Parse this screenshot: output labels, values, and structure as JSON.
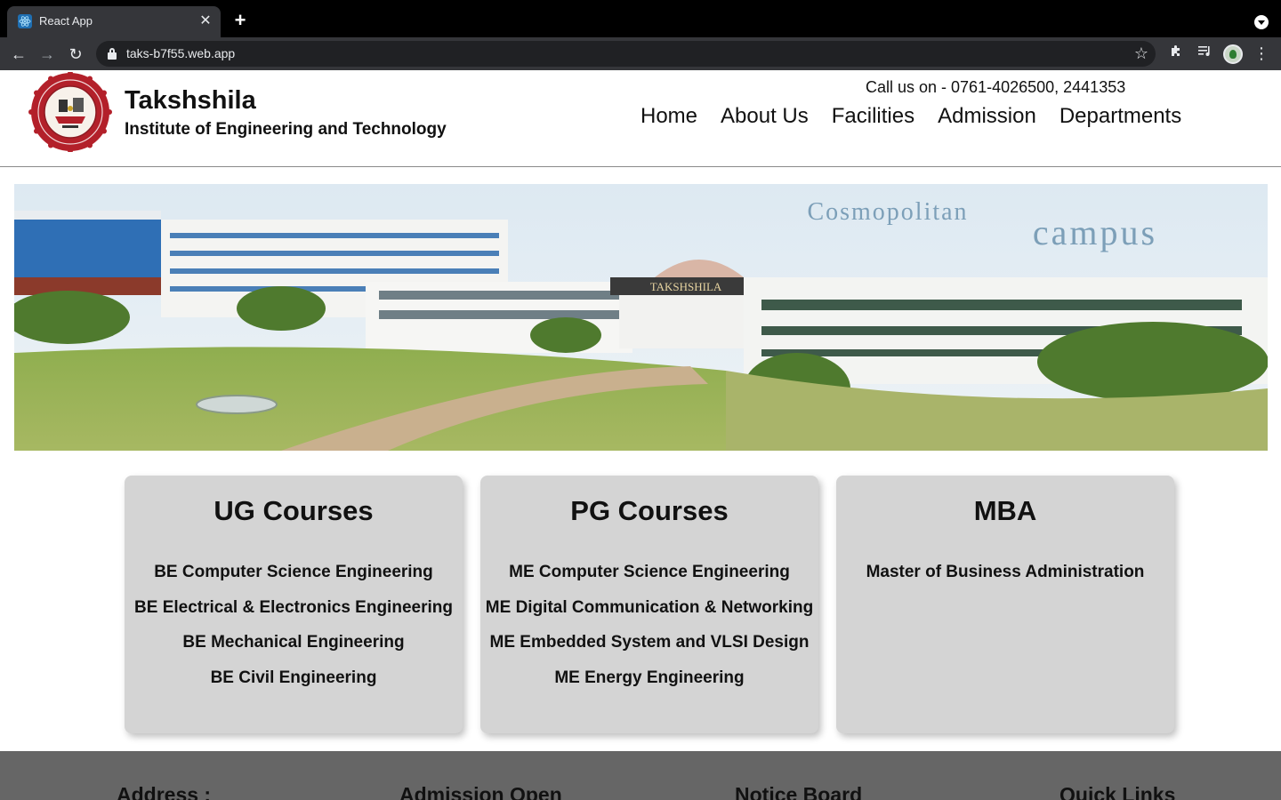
{
  "browser": {
    "tab_title": "React App",
    "tab_close": "✕",
    "new_tab": "+",
    "url": "taks-b7f55.web.app"
  },
  "header": {
    "brand_name": "Takshshila",
    "brand_subtitle": "Institute of Engineering and Technology",
    "phone": "Call us on - 0761-4026500, 2441353",
    "nav": [
      "Home",
      "About Us",
      "Facilities",
      "Admission",
      "Departments"
    ]
  },
  "hero": {
    "caption_line1": "Cosmopolitan",
    "caption_line2": "campus",
    "building_sign": "TAKSHSHILA"
  },
  "courses": [
    {
      "title": "UG Courses",
      "items": [
        "BE Computer Science Engineering",
        "BE Electrical & Electronics Engineering",
        "BE Mechanical Engineering",
        "BE Civil Engineering"
      ]
    },
    {
      "title": "PG Courses",
      "items": [
        "ME Computer Science Engineering",
        "ME Digital Communication & Networking",
        "ME Embedded System and VLSI Design",
        "ME Energy Engineering"
      ]
    },
    {
      "title": "MBA",
      "items": [
        "Master of Business Administration"
      ]
    }
  ],
  "footer": {
    "address": "Address :",
    "admission": "Admission Open",
    "notice": "Notice Board",
    "links": "Quick Links"
  },
  "colors": {
    "card_bg": "#d4d4d4",
    "footer_bg": "#666666",
    "chrome_dark": "#35363a"
  }
}
